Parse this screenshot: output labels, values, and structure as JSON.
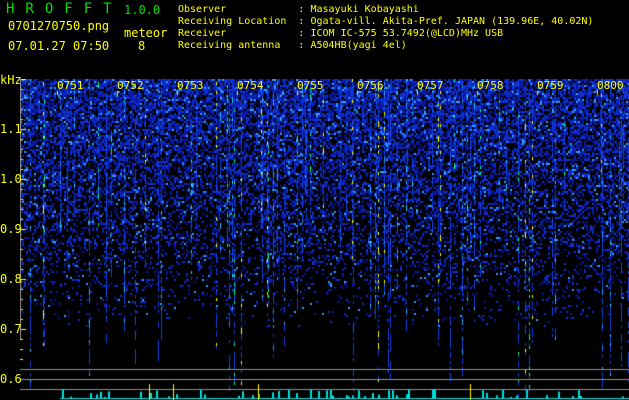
{
  "header": {
    "app_title": "HROFFT",
    "version": "1.0.0",
    "filename": "0701270750.png",
    "datetime": "07.01.27 07:50",
    "meteor_label": "meteor",
    "meteor_count": "8"
  },
  "info": [
    {
      "label": "Observer            ",
      "value": ": Masayuki Kobayashi"
    },
    {
      "label": "Receiving Location  ",
      "value": ": Ogata-vill. Akita-Pref. JAPAN (139.96E, 40.02N)"
    },
    {
      "label": "Receiver            ",
      "value": ": ICOM IC-575 53.7492(@LCD)MHz USB"
    },
    {
      "label": "Receiving antenna   ",
      "value": ": A504HB(yagi 4el)"
    }
  ],
  "axis": {
    "unit": "kHz",
    "freq_labels": [
      "1.1",
      "1.0",
      "0.9",
      "0.8",
      "0.7",
      "0.6"
    ],
    "time_labels": [
      "0751",
      "0752",
      "0753",
      "0754",
      "0755",
      "0756",
      "0757",
      "0758",
      "0759",
      "0800"
    ]
  },
  "colors": {
    "text": "#ffff00",
    "title": "#00e000",
    "noise": "#1020c0",
    "echo": "#00ffff"
  }
}
